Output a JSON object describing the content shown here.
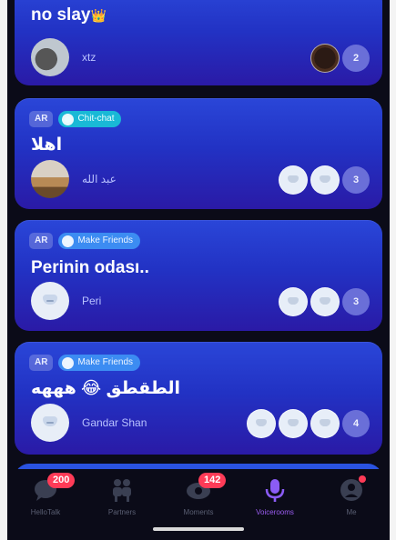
{
  "rooms": [
    {
      "title": "no slay",
      "title_emoji": "👑",
      "host_name": "xtz",
      "member_count": "2"
    },
    {
      "lang": "AR",
      "topic": "Chit-chat",
      "title": "اهلا",
      "host_name": "عبد الله",
      "member_count": "3"
    },
    {
      "lang": "AR",
      "topic": "Make Friends",
      "title": "Perinin odası..",
      "host_name": "Peri",
      "member_count": "3"
    },
    {
      "lang": "AR",
      "topic": "Make Friends",
      "title": "الطقطق 😂 هههه",
      "host_name": "Gandar Shan",
      "member_count": "4"
    }
  ],
  "nav": {
    "tabs": [
      {
        "label": "HelloTalk",
        "icon": "chat-bubble-icon",
        "badge": "200"
      },
      {
        "label": "Partners",
        "icon": "people-icon"
      },
      {
        "label": "Moments",
        "icon": "moments-icon",
        "badge": "142"
      },
      {
        "label": "Voicerooms",
        "icon": "microphone-icon"
      },
      {
        "label": "Me",
        "icon": "profile-icon"
      }
    ],
    "active_tab": "Voicerooms"
  },
  "colors": {
    "accent_purple": "#8b5cf6",
    "badge_red": "#ff3b57",
    "topic_cyan": "#19b9d6",
    "topic_blue": "#3c8cf2"
  }
}
